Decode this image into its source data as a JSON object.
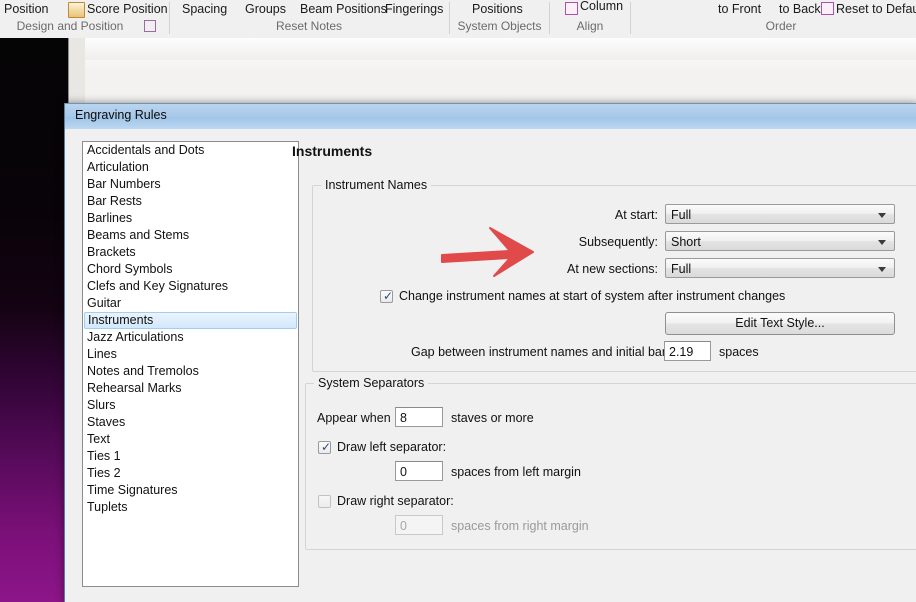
{
  "ribbon": {
    "groups": [
      {
        "name": "design-and-position",
        "label": "Design and Position",
        "items": [
          {
            "text": "Position",
            "icon": "position-icon"
          },
          {
            "text": "Score Position",
            "icon": "score-position-icon"
          }
        ],
        "has_dialog_launcher": true
      },
      {
        "name": "reset-notes",
        "label": "Reset Notes",
        "items": [
          {
            "text": "Spacing",
            "icon": ""
          },
          {
            "text": "Groups",
            "icon": ""
          },
          {
            "text": "Beam Positions",
            "icon": ""
          },
          {
            "text": "Fingerings",
            "icon": ""
          }
        ],
        "has_dialog_launcher": false
      },
      {
        "name": "system-objects",
        "label": "System Objects",
        "items": [
          {
            "text": "Positions",
            "icon": ""
          }
        ],
        "has_dialog_launcher": false
      },
      {
        "name": "align",
        "label": "Align",
        "items": [
          {
            "text": "Column",
            "icon": "column-icon"
          }
        ],
        "has_dialog_launcher": false
      },
      {
        "name": "order",
        "label": "Order",
        "items": [
          {
            "text": "to Front",
            "icon": ""
          },
          {
            "text": "to Back",
            "icon": ""
          },
          {
            "text": "Reset to Default",
            "icon": "reset-to-default-icon"
          }
        ],
        "has_dialog_launcher": false
      }
    ]
  },
  "dialog": {
    "title": "Engraving Rules",
    "panel_title": "Instruments",
    "categories": [
      {
        "label": "Accidentals and Dots",
        "selected": false
      },
      {
        "label": "Articulation",
        "selected": false
      },
      {
        "label": "Bar Numbers",
        "selected": false
      },
      {
        "label": "Bar Rests",
        "selected": false
      },
      {
        "label": "Barlines",
        "selected": false
      },
      {
        "label": "Beams and Stems",
        "selected": false
      },
      {
        "label": "Brackets",
        "selected": false
      },
      {
        "label": "Chord Symbols",
        "selected": false
      },
      {
        "label": "Clefs and Key Signatures",
        "selected": false
      },
      {
        "label": "Guitar",
        "selected": false
      },
      {
        "label": "Instruments",
        "selected": true
      },
      {
        "label": "Jazz Articulations",
        "selected": false
      },
      {
        "label": "Lines",
        "selected": false
      },
      {
        "label": "Notes and Tremolos",
        "selected": false
      },
      {
        "label": "Rehearsal Marks",
        "selected": false
      },
      {
        "label": "Slurs",
        "selected": false
      },
      {
        "label": "Staves",
        "selected": false
      },
      {
        "label": "Text",
        "selected": false
      },
      {
        "label": "Ties 1",
        "selected": false
      },
      {
        "label": "Ties 2",
        "selected": false
      },
      {
        "label": "Time Signatures",
        "selected": false
      },
      {
        "label": "Tuplets",
        "selected": false
      }
    ],
    "instrument_names": {
      "group_title": "Instrument Names",
      "at_start_label": "At start:",
      "at_start_value": "Full",
      "subsequently_label": "Subsequently:",
      "subsequently_value": "Short",
      "at_new_sections_label": "At new sections:",
      "at_new_sections_value": "Full",
      "change_names_checkbox_label": "Change instrument names at start of system after instrument changes",
      "change_names_checked": true,
      "edit_text_style_button": "Edit Text Style...",
      "gap_label": "Gap between instrument names and initial barline",
      "gap_value": "2.19",
      "gap_units": "spaces"
    },
    "system_separators": {
      "group_title": "System Separators",
      "appear_when_label": "Appear when",
      "appear_when_value": "8",
      "appear_when_suffix": "staves or more",
      "draw_left_label": "Draw left separator:",
      "draw_left_checked": true,
      "left_margin_value": "0",
      "left_margin_suffix": "spaces from left margin",
      "draw_right_label": "Draw right separator:",
      "draw_right_checked": false,
      "right_margin_value": "0",
      "right_margin_suffix": "spaces from right margin"
    }
  },
  "annotation": {
    "arrow_color": "#e04a4a",
    "arrow_name": "red-annotation-arrow",
    "points_to": "Subsequently:"
  }
}
